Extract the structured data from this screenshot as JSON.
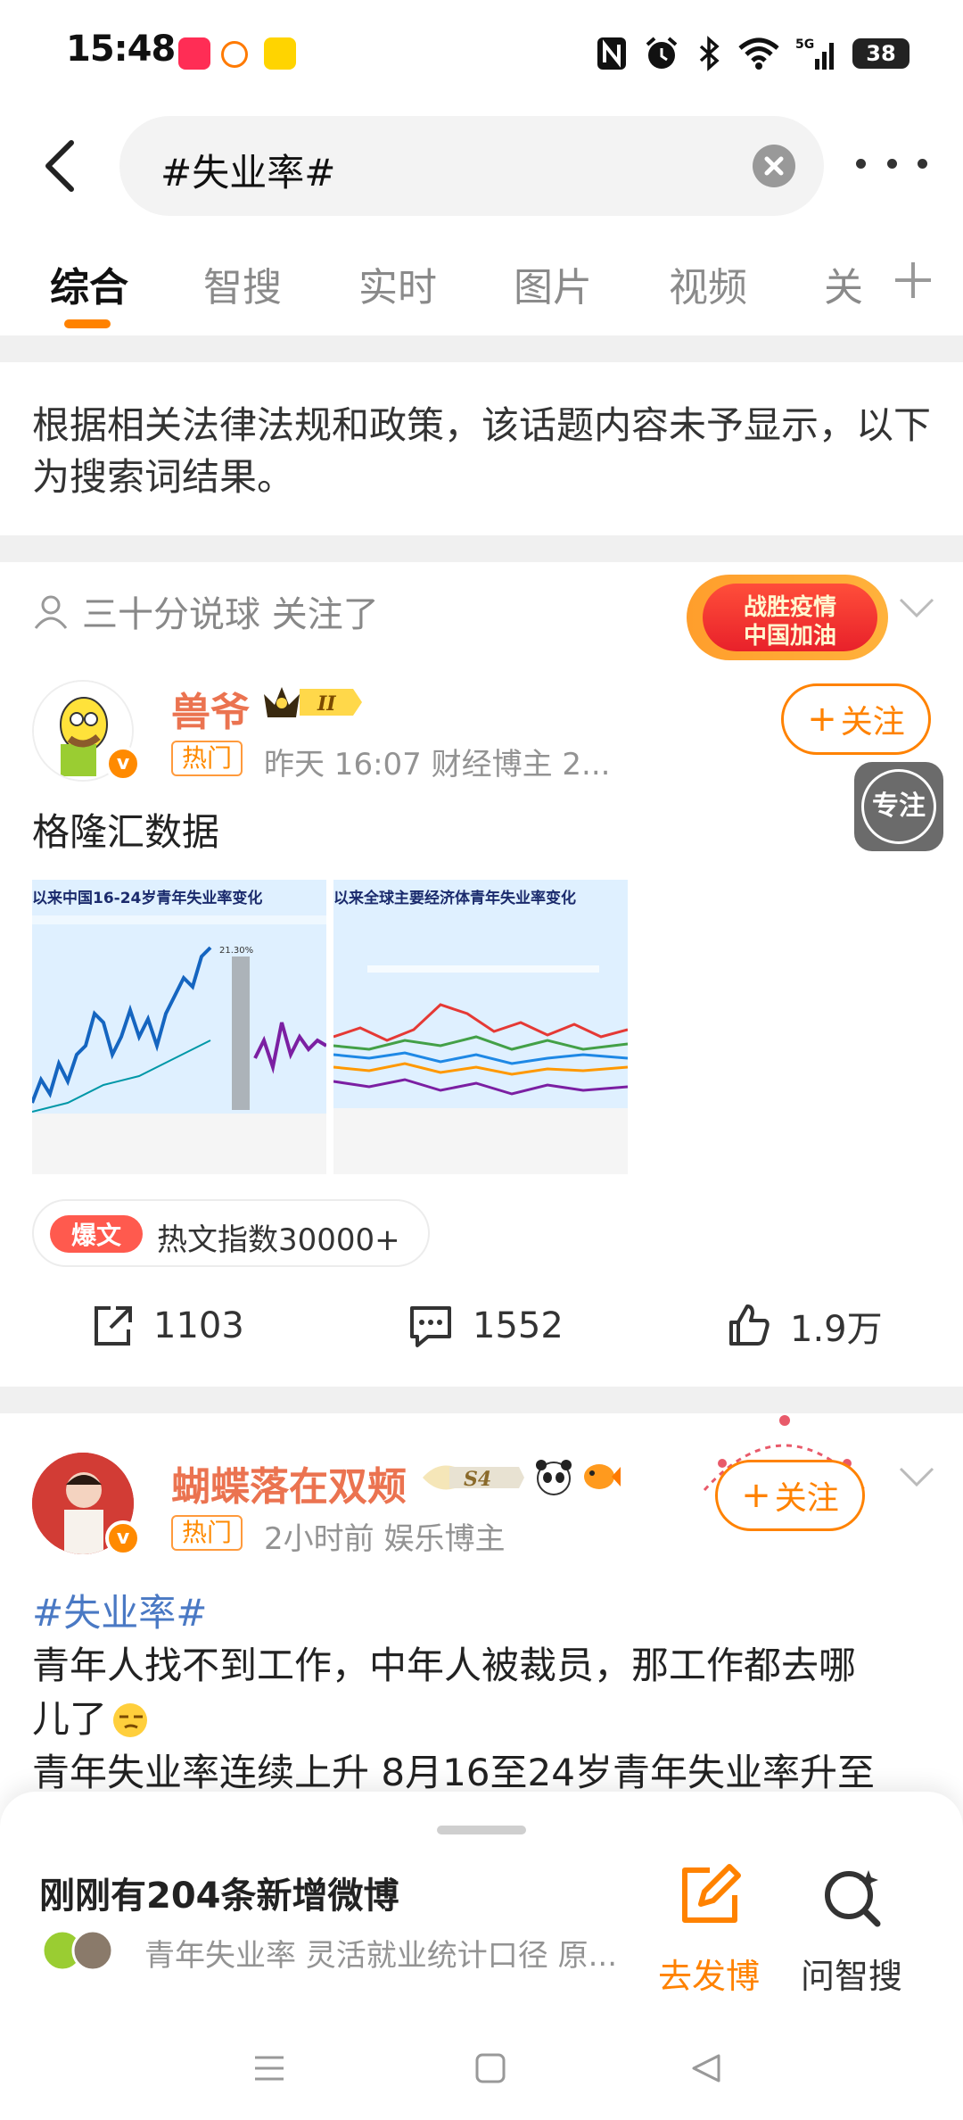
{
  "status": {
    "time": "15:48",
    "network": "5G",
    "battery": "38"
  },
  "search": {
    "query": "#失业率#"
  },
  "tabs": [
    "综合",
    "智搜",
    "实时",
    "图片",
    "视频",
    "关"
  ],
  "notice": "根据相关法律法规和政策，该话题内容未予显示，以下为搜索词结果。",
  "post1": {
    "follow_info": "三十分说球 关注了",
    "promo_line1": "战胜疫情",
    "promo_line2": "中国加油",
    "author": "兽爷",
    "level_badge": "II",
    "hot_tag": "热门",
    "meta": "昨天 16:07   财经博主 2...",
    "follow_label": "关注",
    "text": "格隆汇数据",
    "image1_title": "以来中国16-24岁青年失业率变化",
    "image1_peak": "21.30%",
    "image2_title": "以来全球主要经济体青年失业率变化",
    "hot_pill": "爆文",
    "hot_index": "热文指数30000+",
    "reposts": "1103",
    "comments": "1552",
    "likes": "1.9万"
  },
  "floating": {
    "label": "专注"
  },
  "post2": {
    "author": "蝴蝶落在双颊",
    "level_badge": "S4",
    "hot_tag": "热门",
    "meta": "2小时前   娱乐博主",
    "follow_label": "关注",
    "topic": "#失业率#",
    "line1": "青年人找不到工作，中年人被裁员，那工作都去哪",
    "line2": "儿了",
    "line3": "青年失业率连续上升 8月16至24岁青年失业率升至"
  },
  "sheet": {
    "title": "刚刚有204条新增微博",
    "subtitle": "青年失业率 灵活就业统计口径 原...",
    "post_label": "去发博",
    "ask_label": "问智搜"
  },
  "colors": {
    "accent": "#ff8200",
    "link": "#4a79c4",
    "username": "#eb7350"
  }
}
